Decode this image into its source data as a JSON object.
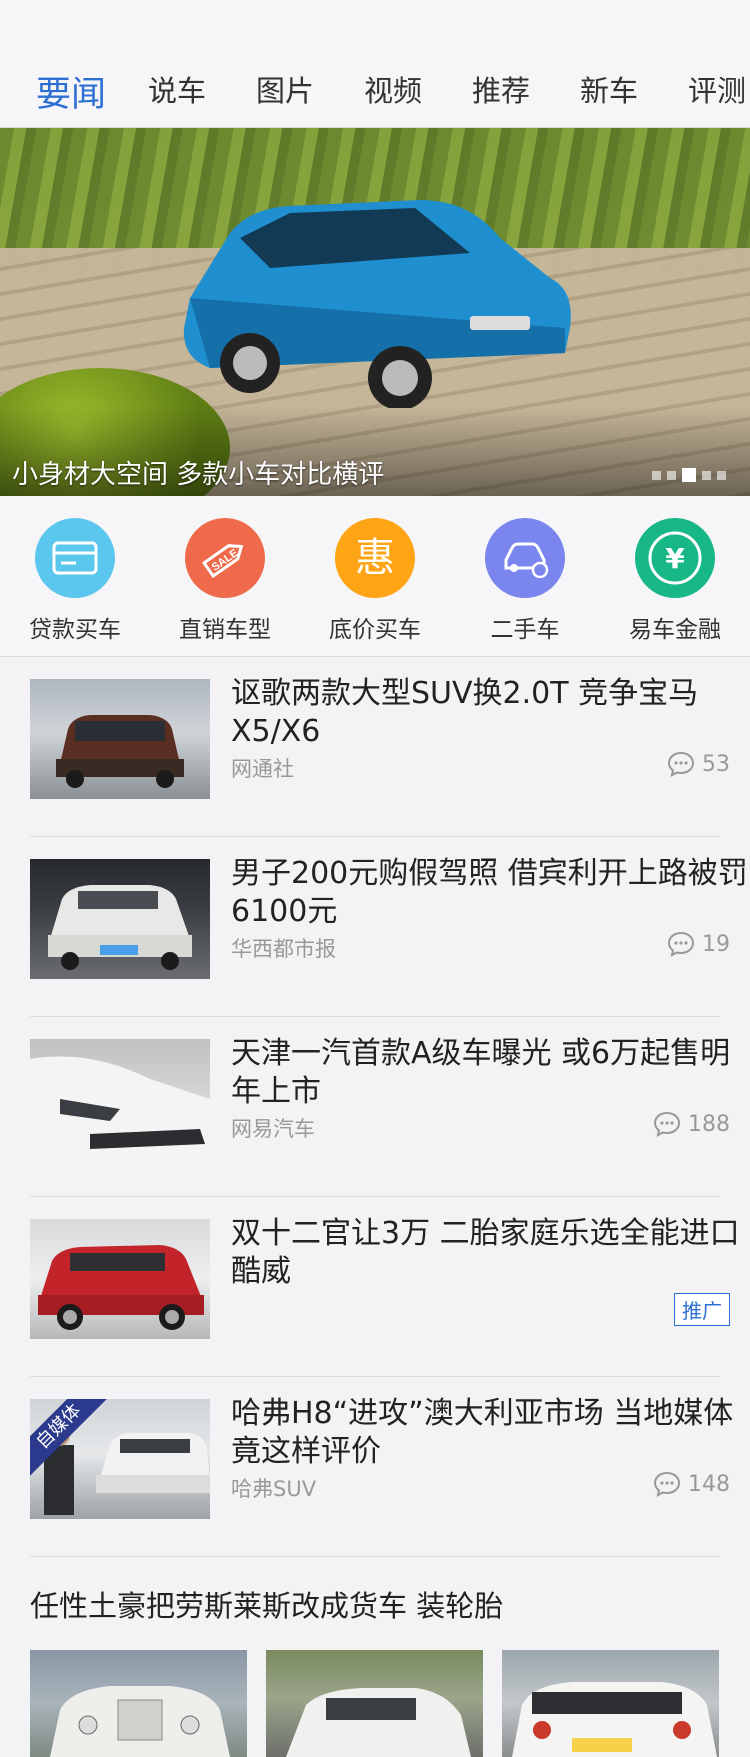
{
  "tabs": [
    "要闻",
    "说车",
    "图片",
    "视频",
    "推荐",
    "新车",
    "评测"
  ],
  "banner": {
    "caption": "小身材大空间 多款小车对比横评",
    "page_count": 5,
    "current_page": 3
  },
  "shortcuts": [
    {
      "label": "贷款买车",
      "icon": "card-icon",
      "color": "#5cc7ee"
    },
    {
      "label": "直销车型",
      "icon": "sale-tag-icon",
      "color": "#ee6a4a"
    },
    {
      "label": "底价买车",
      "icon": "hui-icon",
      "color": "#ffa414"
    },
    {
      "label": "二手车",
      "icon": "car-exchange-icon",
      "color": "#7a86ee"
    },
    {
      "label": "易车金融",
      "icon": "yen-icon",
      "color": "#17b886"
    }
  ],
  "news": [
    {
      "title": "讴歌两款大型SUV换2.0T 竞争宝马X5/X6",
      "source": "网通社",
      "comments": "53"
    },
    {
      "title": "男子200元购假驾照 借宾利开上路被罚6100元",
      "source": "华西都市报",
      "comments": "19"
    },
    {
      "title": "天津一汽首款A级车曝光 或6万起售明年上市",
      "source": "网易汽车",
      "comments": "188"
    },
    {
      "title": "双十二官让3万 二胎家庭乐选全能进口酷威",
      "promo": "推广"
    },
    {
      "title": "哈弗H8“进攻”澳大利亚市场 当地媒体竟这样评价",
      "source": "哈弗SUV",
      "comments": "148",
      "tag": "自媒体"
    }
  ],
  "gallery": {
    "title": "任性土豪把劳斯莱斯改成货车 装轮胎"
  },
  "colors": {
    "accent": "#2d6fd3"
  }
}
